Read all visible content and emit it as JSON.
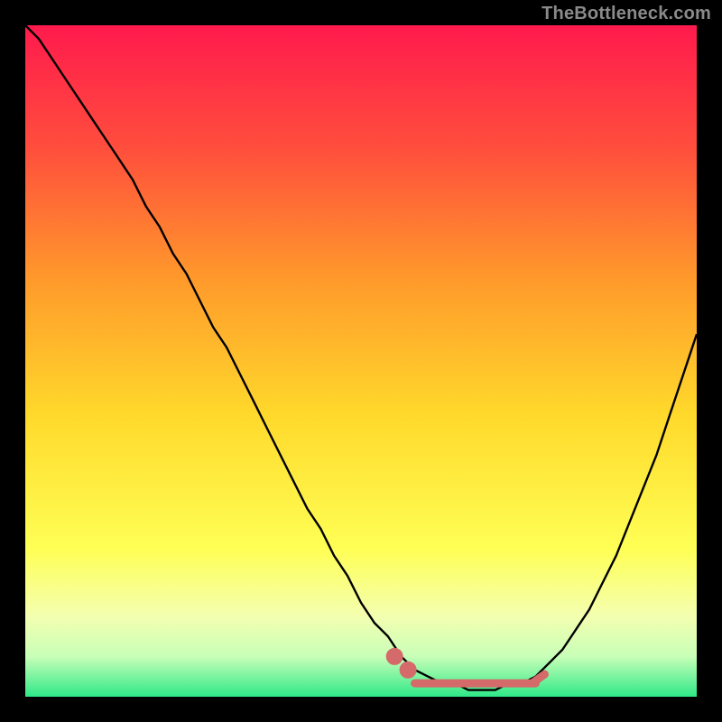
{
  "watermark": "TheBottleneck.com",
  "colors": {
    "black": "#000000",
    "curve": "#000000",
    "accent": "#d46a6a",
    "grad_top": "#ff1a4d",
    "grad_mid1": "#ff8a2b",
    "grad_mid2": "#ffe733",
    "grad_low1": "#f7ff8a",
    "grad_low2": "#d7ffb0",
    "grad_bottom": "#2fe888"
  },
  "chart_data": {
    "type": "line",
    "title": "",
    "xlabel": "",
    "ylabel": "",
    "xlim": [
      0,
      100
    ],
    "ylim": [
      0,
      100
    ],
    "annotations": [],
    "x": [
      0,
      2,
      4,
      6,
      8,
      10,
      12,
      14,
      16,
      18,
      20,
      22,
      24,
      26,
      28,
      30,
      32,
      34,
      36,
      38,
      40,
      42,
      44,
      46,
      48,
      50,
      52,
      54,
      56,
      58,
      60,
      62,
      64,
      66,
      68,
      70,
      72,
      74,
      76,
      78,
      80,
      82,
      84,
      86,
      88,
      90,
      92,
      94,
      96,
      98,
      100
    ],
    "series": [
      {
        "name": "bottleneck-curve",
        "values": [
          100,
          98,
          95,
          92,
          89,
          86,
          83,
          80,
          77,
          73,
          70,
          66,
          63,
          59,
          55,
          52,
          48,
          44,
          40,
          36,
          32,
          28,
          25,
          21,
          18,
          14,
          11,
          9,
          6,
          4,
          3,
          2,
          2,
          1,
          1,
          1,
          2,
          2,
          3,
          5,
          7,
          10,
          13,
          17,
          21,
          26,
          31,
          36,
          42,
          48,
          54
        ]
      }
    ],
    "flat_region": {
      "x_start": 58,
      "x_end": 76,
      "y": 2,
      "style": "thick-accent-dotted"
    }
  }
}
